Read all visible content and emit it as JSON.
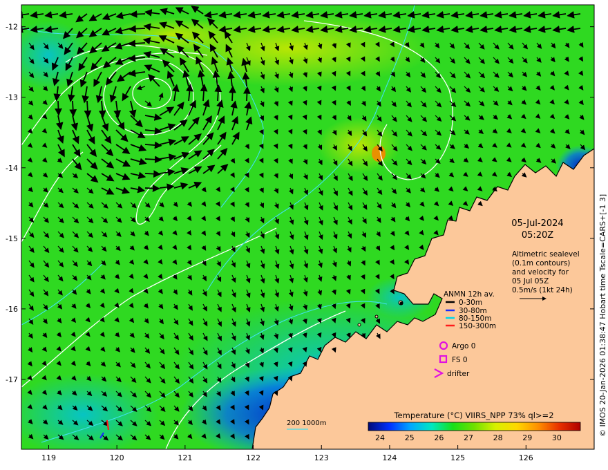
{
  "date": "05-Jul-2024",
  "time": "05:20Z",
  "altimetry_note": [
    "Altimetric sealevel",
    "(0.1m contours)",
    "and velocity for",
    "05 Jul 05Z",
    "0.5m/s (1kt 24h)"
  ],
  "anmn_legend": {
    "title": "ANMN 12h av.",
    "items": [
      {
        "label": "0-30m",
        "color": "#000000"
      },
      {
        "label": "30-80m",
        "color": "#1a2cff"
      },
      {
        "label": "80-150m",
        "color": "#00d8e8"
      },
      {
        "label": "150-300m",
        "color": "#ff1a1a"
      }
    ]
  },
  "markers": [
    {
      "label": "Argo 0",
      "symbol": "circle",
      "color": "#e010e0"
    },
    {
      "label": "FS 0",
      "symbol": "square",
      "color": "#e010e0"
    },
    {
      "label": "drifter",
      "symbol": "chevron",
      "color": "#e010e0"
    }
  ],
  "isobath_label": "200  1000m",
  "colorbar": {
    "title": "Temperature (°C) VIIRS_NPP 73% ql>=2",
    "ticks": [
      "24",
      "25",
      "26",
      "27",
      "28",
      "29",
      "30"
    ],
    "range": [
      23.6,
      30.8
    ],
    "colors": [
      "#000a78",
      "#0030ff",
      "#00a8ff",
      "#00e8c0",
      "#18e018",
      "#70e000",
      "#d8f000",
      "#ffd800",
      "#ff9000",
      "#e83000",
      "#b00000"
    ]
  },
  "x_ticks": [
    "119",
    "120",
    "121",
    "122",
    "123",
    "124",
    "125",
    "126"
  ],
  "y_ticks": [
    "-12",
    "-13",
    "-14",
    "-15",
    "-16",
    "-17"
  ],
  "credit": "© IMOS 20-Jan-2026 01:38:47 Hobart time Tscale=CARS+[-1 3]",
  "map_extent": {
    "lon": [
      118.6,
      127.0
    ],
    "lat": [
      -17.99,
      -11.69
    ]
  },
  "land_color": "#fcc89a"
}
